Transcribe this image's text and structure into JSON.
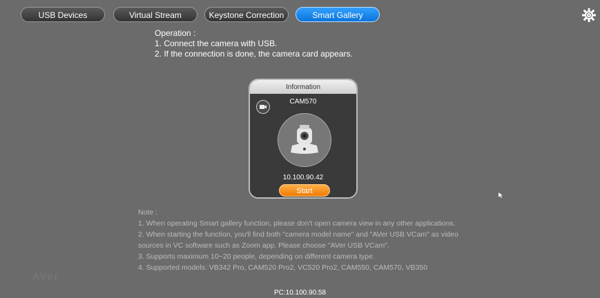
{
  "tabs": [
    {
      "label": "USB Devices",
      "active": false
    },
    {
      "label": "Virtual Stream",
      "active": false
    },
    {
      "label": "Keystone Correction",
      "active": false
    },
    {
      "label": "Smart Gallery",
      "active": true
    }
  ],
  "operation": {
    "title": "Operation :",
    "steps": [
      "1. Connect the camera with USB.",
      "2. If the connection is done, the camera card appears."
    ]
  },
  "card": {
    "header": "Information",
    "model": "CAM570",
    "ip": "10.100.90.42",
    "start_label": "Start"
  },
  "note": {
    "title": "Note :",
    "lines": [
      "1. When operating Smart gallery function, please don't open camera view in any other applications.",
      "2. When starting the function, you'll find both \"camera model name\" and \"AVer USB VCam\" as video",
      "sources in VC software such as Zoom app. Please choose \"AVer USB VCam\".",
      "3. Supports maximum 10~20 people, depending on different camera type.",
      "4. Supported models: VB342 Pro, CAM520 Pro2, VC520 Pro2, CAM550, CAM570, VB350"
    ]
  },
  "footer": {
    "pc": "PC:10.100.90.58"
  },
  "watermark": "AVer",
  "colors": {
    "background": "#6b6b6b",
    "active_tab": "#1a8cff",
    "start": "#f08a12"
  }
}
